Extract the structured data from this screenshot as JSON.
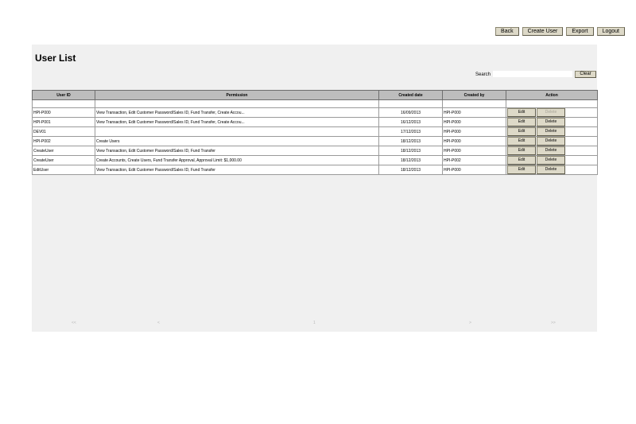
{
  "nav": {
    "back": "Back",
    "create_user": "Create User",
    "export": "Export",
    "logout": "Logout"
  },
  "page_title": "User List",
  "search": {
    "label": "Search",
    "value": "",
    "clear_label": "Clear"
  },
  "table": {
    "headers": {
      "user_id": "User ID",
      "permission": "Permission",
      "created_date": "Created date",
      "created_by": "Created by",
      "action": "Action"
    },
    "rows": [
      {
        "user_id": "HPI-P000",
        "permission": "View Transaction, Edit Customer Password/Sales ID, Fund Transfer, Create Accou...",
        "created_date": "16/09/2013",
        "created_by": "HPI-P000",
        "edit": "Edit",
        "delete": "Delete"
      },
      {
        "user_id": "HPI-P001",
        "permission": "View Transaction, Edit Customer Password/Sales ID, Fund Transfer, Create Accou...",
        "created_date": "16/12/2013",
        "created_by": "HPI-P000",
        "edit": "Edit",
        "delete": "Delete"
      },
      {
        "user_id": "DEV01",
        "permission": "",
        "created_date": "17/12/2013",
        "created_by": "HPI-P000",
        "edit": "Edit",
        "delete": "Delete"
      },
      {
        "user_id": "HPI-P002",
        "permission": "Create Users",
        "created_date": "18/12/2013",
        "created_by": "HPI-P000",
        "edit": "Edit",
        "delete": "Delete"
      },
      {
        "user_id": "CreateUser",
        "permission": "View Transaction, Edit Customer Password/Sales ID, Fund Transfer",
        "created_date": "18/12/2013",
        "created_by": "HPI-P000",
        "edit": "Edit",
        "delete": "Delete"
      },
      {
        "user_id": "CreateUser",
        "permission": "Create Accounts, Create Users, Fund Transfer Approval, Approval Limit: $1,000.00",
        "created_date": "18/12/2013",
        "created_by": "HPI-P002",
        "edit": "Edit",
        "delete": "Delete"
      },
      {
        "user_id": "EditUser",
        "permission": "View Transaction, Edit Customer Password/Sales ID, Fund Transfer",
        "created_date": "18/12/2013",
        "created_by": "HPI-P000",
        "edit": "Edit",
        "delete": "Delete"
      }
    ]
  },
  "pager": {
    "first": "<<",
    "prev": "<",
    "page": "1",
    "next": ">",
    "last": ">>"
  },
  "colors": {
    "button_bg": "#ddd9c8",
    "header_bg": "#bdbdbd",
    "panel_bg": "#f0f0f0"
  }
}
